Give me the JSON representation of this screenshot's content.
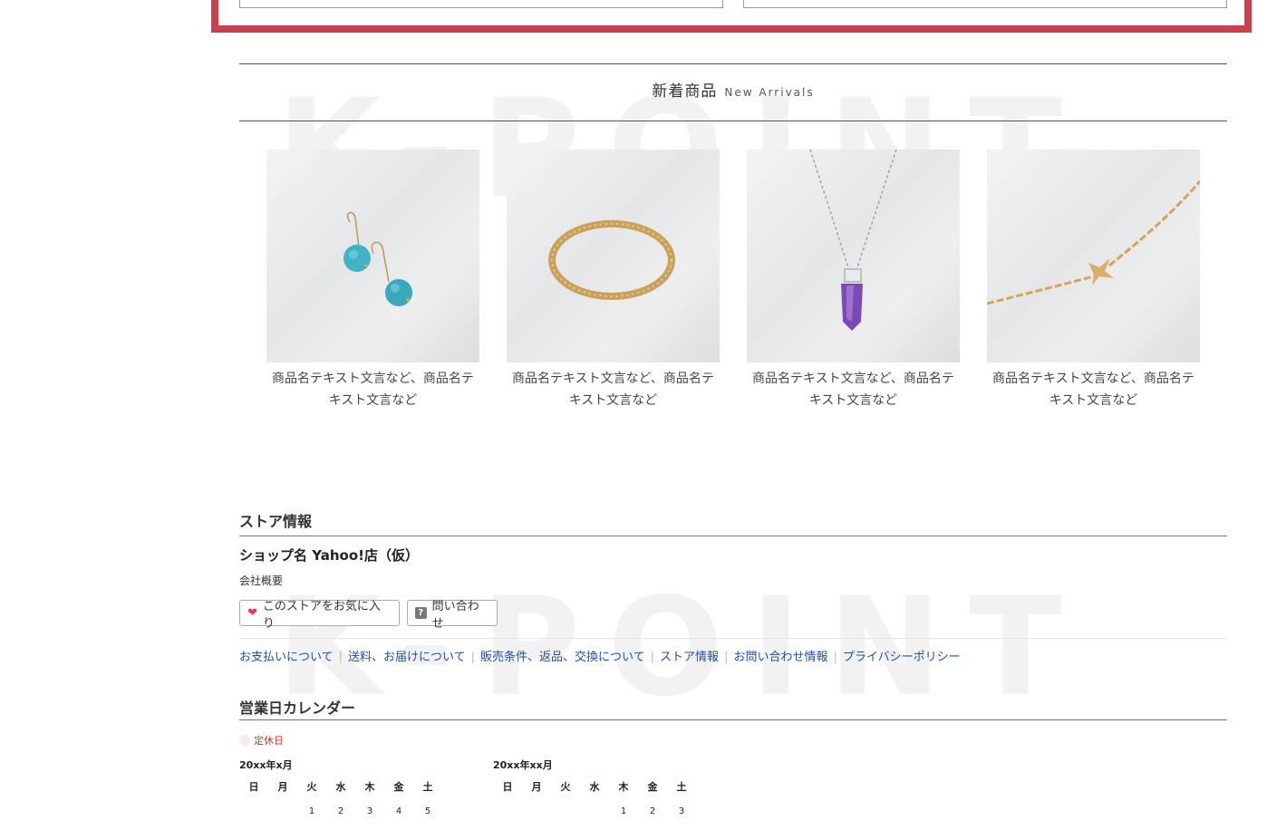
{
  "new_arrivals": {
    "title_jp": "新着商品",
    "title_en": "New Arrivals",
    "watermark": "K-POINT",
    "products": [
      {
        "name": "商品名テキスト文言など、商品名テキスト文言など",
        "image": "turquoise-earrings"
      },
      {
        "name": "商品名テキスト文言など、商品名テキスト文言など",
        "image": "gold-bangle"
      },
      {
        "name": "商品名テキスト文言など、商品名テキスト文言など",
        "image": "amethyst-pendant"
      },
      {
        "name": "商品名テキスト文言など、商品名テキスト文言など",
        "image": "bird-bracelet"
      }
    ]
  },
  "store_info": {
    "title": "ストア情報",
    "shop_name": "ショップ名 Yahoo!店（仮）",
    "company_link": "会社概要",
    "favorite_button": "このストアをお気に入り",
    "contact_button": "問い合わせ",
    "links": [
      "お支払いについて",
      "送料、お届けについて",
      "販売条件、返品、交換について",
      "ストア情報",
      "お問い合わせ情報",
      "プライバシーポリシー"
    ]
  },
  "calendar": {
    "title": "営業日カレンダー",
    "legend": "定休日",
    "weekdays": [
      "日",
      "月",
      "火",
      "水",
      "木",
      "金",
      "土"
    ],
    "months": [
      {
        "label": "20xx年x月",
        "first_row": [
          "",
          "",
          "1",
          "2",
          "3",
          "4",
          "5"
        ]
      },
      {
        "label": "20xx年xx月",
        "first_row": [
          "",
          "",
          "",
          "",
          "1",
          "2",
          "3"
        ]
      }
    ]
  },
  "colors": {
    "accent_red": "#c9414f",
    "link_blue": "#1f4fa6"
  }
}
